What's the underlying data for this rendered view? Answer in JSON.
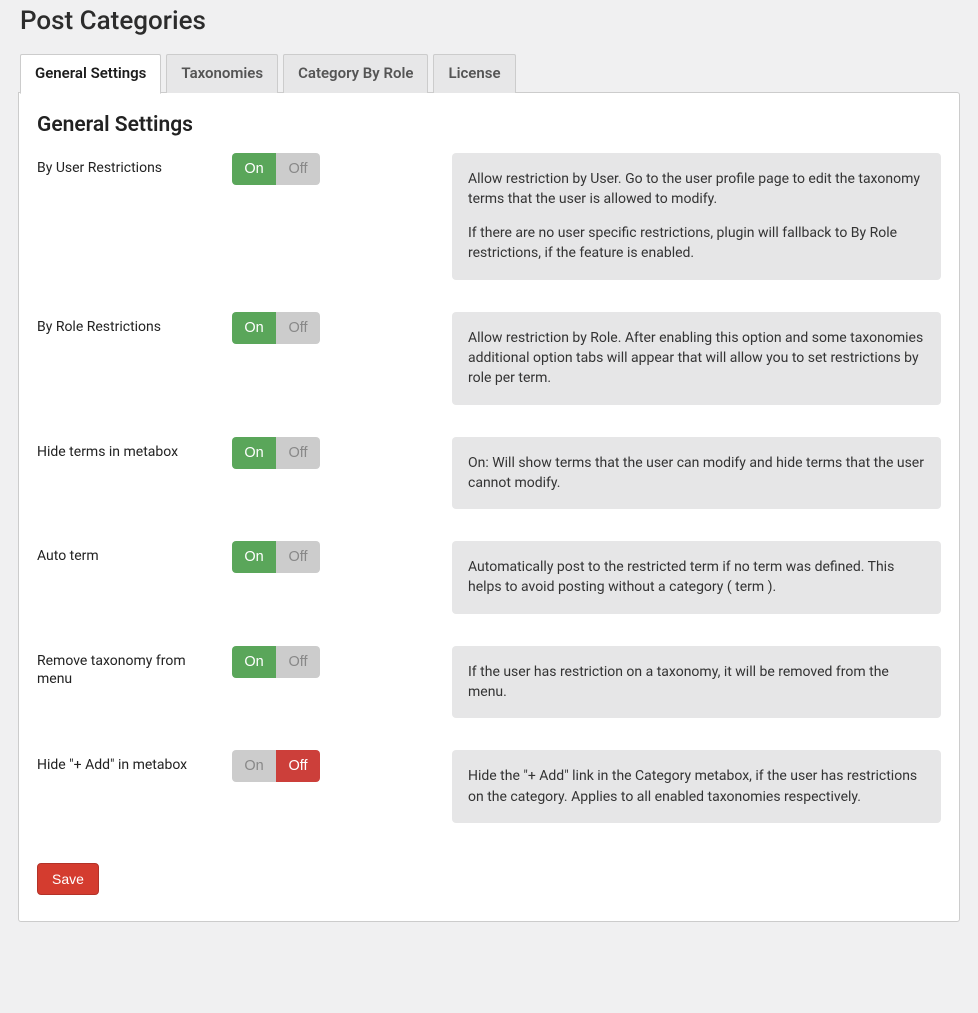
{
  "page": {
    "title": "Post Categories"
  },
  "tabs": [
    {
      "label": "General Settings",
      "active": true
    },
    {
      "label": "Taxonomies",
      "active": false
    },
    {
      "label": "Category By Role",
      "active": false
    },
    {
      "label": "License",
      "active": false
    }
  ],
  "section": {
    "title": "General Settings"
  },
  "toggle_labels": {
    "on": "On",
    "off": "Off"
  },
  "settings": [
    {
      "key": "by_user_restrictions",
      "label": "By User Restrictions",
      "value": "on",
      "desc": [
        "Allow restriction by User. Go to the user profile page to edit the taxonomy terms that the user is allowed to modify.",
        "If there are no user specific restrictions, plugin will fallback to By Role restrictions, if the feature is enabled."
      ]
    },
    {
      "key": "by_role_restrictions",
      "label": "By Role Restrictions",
      "value": "on",
      "desc": [
        "Allow restriction by Role. After enabling this option and some taxonomies additional option tabs will appear that will allow you to set restrictions by role per term."
      ]
    },
    {
      "key": "hide_terms_in_metabox",
      "label": "Hide terms in metabox",
      "value": "on",
      "desc": [
        "On: Will show terms that the user can modify and hide terms that the user cannot modify."
      ]
    },
    {
      "key": "auto_term",
      "label": "Auto term",
      "value": "on",
      "desc": [
        "Automatically post to the restricted term if no term was defined. This helps to avoid posting without a category ( term )."
      ]
    },
    {
      "key": "remove_taxonomy_from_menu",
      "label": "Remove taxonomy from menu",
      "value": "on",
      "desc": [
        "If the user has restriction on a taxonomy, it will be removed from the menu."
      ]
    },
    {
      "key": "hide_add_in_metabox",
      "label": "Hide \"+ Add\" in metabox",
      "value": "off",
      "desc": [
        "Hide the \"+ Add\" link in the Category metabox, if the user has restrictions on the category. Applies to all enabled taxonomies respectively."
      ]
    }
  ],
  "actions": {
    "save": "Save"
  }
}
